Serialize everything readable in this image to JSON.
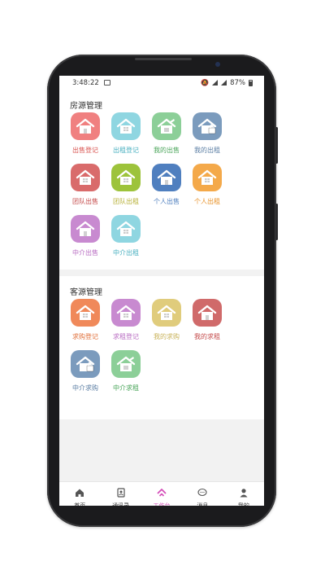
{
  "status_bar": {
    "time": "3:48:22",
    "battery": "87%"
  },
  "sections": [
    {
      "title": "房源管理",
      "items": [
        {
          "label": "出售登记",
          "color": "#f08080",
          "text_color": "#d9534f",
          "icon": "house-icon"
        },
        {
          "label": "出租登记",
          "color": "#8fd6e1",
          "text_color": "#4ab0c0",
          "icon": "house-window-icon"
        },
        {
          "label": "我的出售",
          "color": "#8ccf98",
          "text_color": "#4aa55a",
          "icon": "house-edit-icon"
        },
        {
          "label": "我的出租",
          "color": "#7b9bbd",
          "text_color": "#5a7da3",
          "icon": "house-lock-icon"
        },
        {
          "label": "团队出售",
          "color": "#d96b6b",
          "text_color": "#c44a4a",
          "icon": "house-window-icon"
        },
        {
          "label": "团队出租",
          "color": "#9dc33b",
          "text_color": "#b8b23a",
          "icon": "house-window-icon"
        },
        {
          "label": "个人出售",
          "color": "#4f7fbf",
          "text_color": "#4f7fbf",
          "icon": "house-icon"
        },
        {
          "label": "个人出租",
          "color": "#f4a94a",
          "text_color": "#e8932b",
          "icon": "house-window-icon"
        },
        {
          "label": "中介出售",
          "color": "#c88ad0",
          "text_color": "#b86cc2",
          "icon": "house-icon"
        },
        {
          "label": "中介出租",
          "color": "#8fd6e1",
          "text_color": "#4ab0c0",
          "icon": "house-window-icon"
        }
      ]
    },
    {
      "title": "客源管理",
      "items": [
        {
          "label": "求购登记",
          "color": "#f0895a",
          "text_color": "#e06f3a",
          "icon": "house-window-icon"
        },
        {
          "label": "求租登记",
          "color": "#c88ad0",
          "text_color": "#b86cc2",
          "icon": "house-window-icon"
        },
        {
          "label": "我的求购",
          "color": "#e0cc7c",
          "text_color": "#c9b35a",
          "icon": "house-window-icon"
        },
        {
          "label": "我的求租",
          "color": "#d06a6a",
          "text_color": "#c44a4a",
          "icon": "house-icon"
        },
        {
          "label": "中介求购",
          "color": "#7b9bbd",
          "text_color": "#5a7da3",
          "icon": "house-lock-icon"
        },
        {
          "label": "中介求租",
          "color": "#8ccf98",
          "text_color": "#4aa55a",
          "icon": "house-edit-icon"
        }
      ]
    }
  ],
  "tabs": [
    {
      "label": "首页",
      "icon": "home-icon",
      "active": false
    },
    {
      "label": "通讯录",
      "icon": "contacts-icon",
      "active": false
    },
    {
      "label": "工作台",
      "icon": "workbench-icon",
      "active": true
    },
    {
      "label": "消息",
      "icon": "message-icon",
      "active": false
    },
    {
      "label": "我的",
      "icon": "person-icon",
      "active": false
    }
  ],
  "colors": {
    "accent": "#d44fb9",
    "background": "#f2f2f2"
  }
}
